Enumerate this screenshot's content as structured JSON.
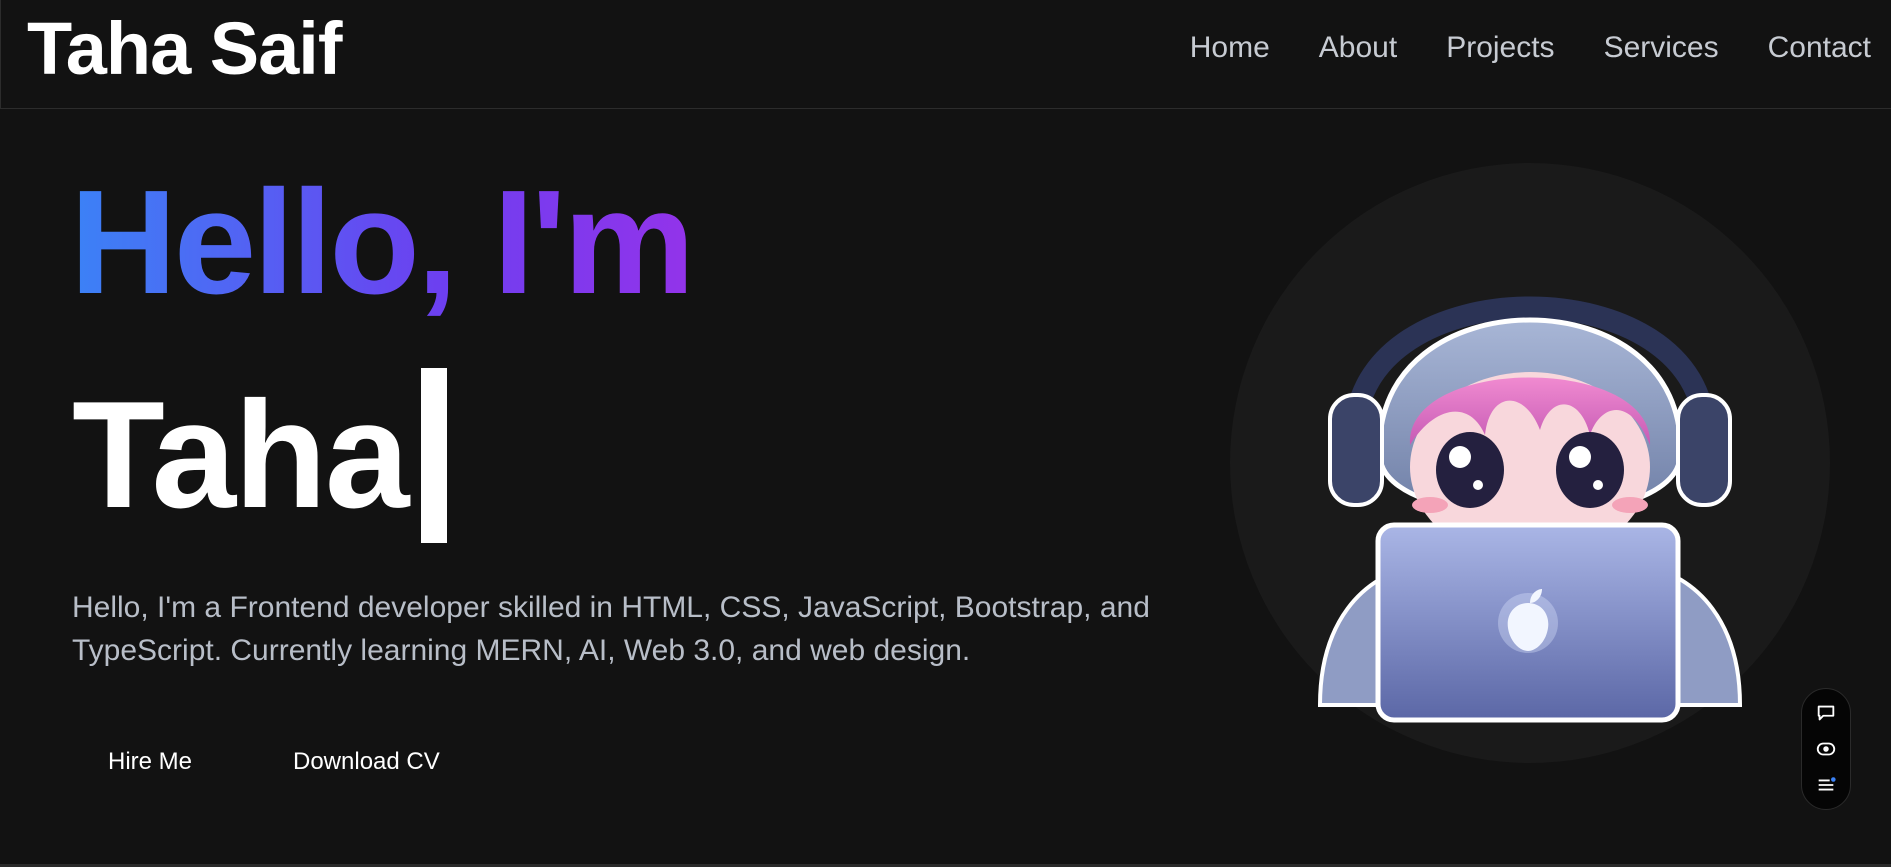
{
  "header": {
    "logo": "Taha Saif",
    "nav": [
      "Home",
      "About",
      "Projects",
      "Services",
      "Contact"
    ]
  },
  "hero": {
    "greeting": "Hello, I'm",
    "typed_name": "Taha",
    "bio": "Hello, I'm a Frontend developer skilled in HTML, CSS, JavaScript, Bootstrap, and TypeScript. Currently learning MERN, AI, Web 3.0, and web design.",
    "buttons": {
      "hire": "Hire Me",
      "cv": "Download CV"
    }
  },
  "avatar": {
    "icon": "anime-avatar-with-laptop"
  },
  "toolbar": {
    "icons": [
      "comment-icon",
      "eye-icon",
      "menu-icon"
    ]
  },
  "colors": {
    "background": "#121212",
    "gradient_start": "#3b82f6",
    "gradient_end": "#9333ea",
    "nav_text": "#c7cbd2",
    "bio_text": "#b8bec8"
  }
}
